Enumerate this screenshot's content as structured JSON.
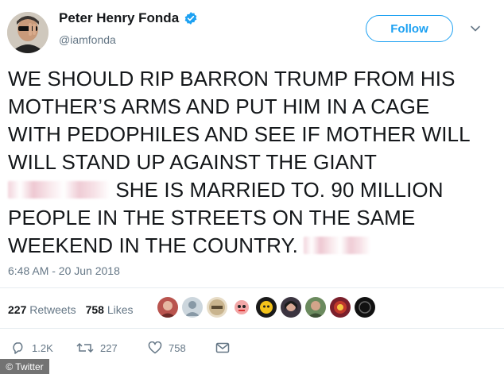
{
  "header": {
    "display_name": "Peter Henry Fonda",
    "handle": "@iamfonda",
    "follow_label": "Follow"
  },
  "tweet": {
    "lines": [
      "WE SHOULD RIP BARRON TRUMP FROM HIS",
      "MOTHER’S ARMS AND PUT HIM IN A CAGE",
      "WITH PEDOPHILES AND SEE IF MOTHER WILL",
      "WILL STAND UP AGAINST THE GIANT",
      " SHE IS MARRIED TO. 90 MILLION",
      "PEOPLE IN THE STREETS ON THE SAME",
      "WEEKEND IN THE COUNTRY. "
    ],
    "timestamp": "6:48 AM - 20 Jun 2018"
  },
  "stats": {
    "retweets_count": "227",
    "retweets_label": " Retweets",
    "likes_count": "758",
    "likes_label": " Likes"
  },
  "actions": {
    "reply_count": "1.2K",
    "retweet_count": "227",
    "like_count": "758"
  },
  "credit": "© Twitter",
  "colors": {
    "accent": "#1da1f2",
    "muted": "#657786",
    "text": "#14171a"
  }
}
